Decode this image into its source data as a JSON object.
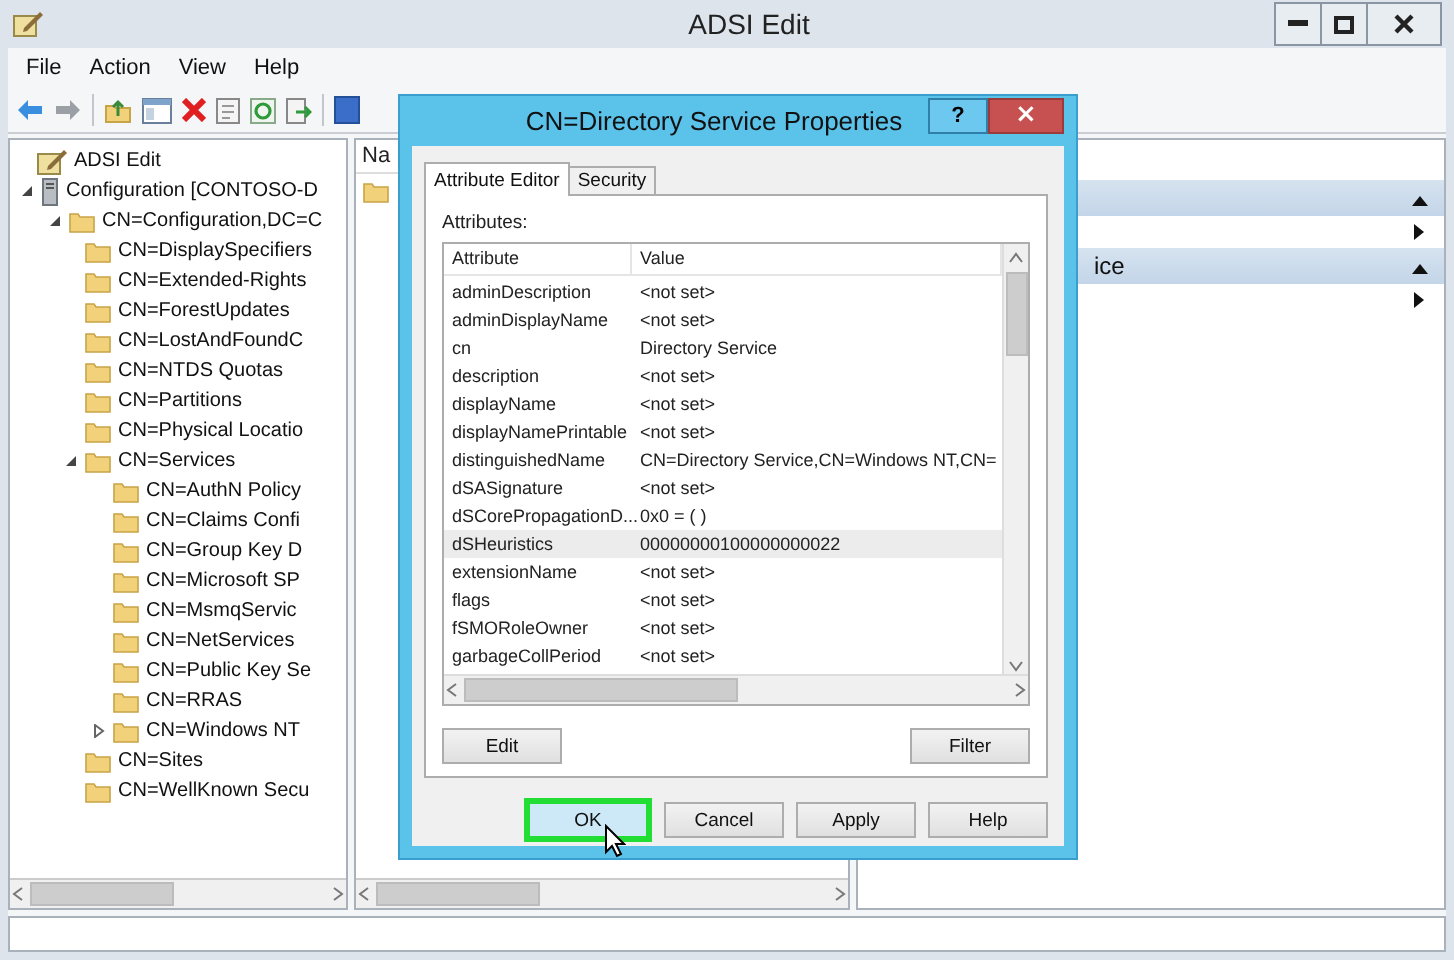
{
  "window": {
    "title": "ADSI Edit"
  },
  "menu": [
    "File",
    "Action",
    "View",
    "Help"
  ],
  "tree": [
    {
      "label": "ADSI Edit",
      "kind": "app",
      "children": [
        {
          "label": "Configuration [CONTOSO-D",
          "kind": "server",
          "expanded": true,
          "children": [
            {
              "label": "CN=Configuration,DC=C",
              "kind": "folder",
              "expanded": true,
              "children": [
                {
                  "label": "CN=DisplaySpecifiers",
                  "kind": "folder"
                },
                {
                  "label": "CN=Extended-Rights",
                  "kind": "folder"
                },
                {
                  "label": "CN=ForestUpdates",
                  "kind": "folder"
                },
                {
                  "label": "CN=LostAndFoundC",
                  "kind": "folder"
                },
                {
                  "label": "CN=NTDS Quotas",
                  "kind": "folder"
                },
                {
                  "label": "CN=Partitions",
                  "kind": "folder"
                },
                {
                  "label": "CN=Physical Locatio",
                  "kind": "folder"
                },
                {
                  "label": "CN=Services",
                  "kind": "folder",
                  "expanded": true,
                  "children": [
                    {
                      "label": "CN=AuthN Policy",
                      "kind": "folder"
                    },
                    {
                      "label": "CN=Claims Confi",
                      "kind": "folder"
                    },
                    {
                      "label": "CN=Group Key D",
                      "kind": "folder"
                    },
                    {
                      "label": "CN=Microsoft SP",
                      "kind": "folder"
                    },
                    {
                      "label": "CN=MsmqServic",
                      "kind": "folder"
                    },
                    {
                      "label": "CN=NetServices",
                      "kind": "folder"
                    },
                    {
                      "label": "CN=Public Key Se",
                      "kind": "folder"
                    },
                    {
                      "label": "CN=RRAS",
                      "kind": "folder"
                    },
                    {
                      "label": "CN=Windows NT",
                      "kind": "folder",
                      "expanded": false
                    }
                  ]
                },
                {
                  "label": "CN=Sites",
                  "kind": "folder"
                },
                {
                  "label": "CN=WellKnown Secu",
                  "kind": "folder"
                }
              ]
            }
          ]
        }
      ]
    }
  ],
  "middle_pane": {
    "column_1": "Na"
  },
  "actions": [
    {
      "expanded": true
    },
    {
      "title": "ice",
      "expanded": true
    }
  ],
  "dialog": {
    "title": "CN=Directory Service Properties",
    "help": "?",
    "close": "×",
    "tabs": [
      {
        "label": "Attribute Editor",
        "selected": true
      },
      {
        "label": "Security",
        "selected": false
      }
    ],
    "attributes_label": "Attributes:",
    "columns": [
      "Attribute",
      "Value"
    ],
    "rows": [
      {
        "attribute": "adminDescription",
        "value": "<not set>",
        "selected": false
      },
      {
        "attribute": "adminDisplayName",
        "value": "<not set>",
        "selected": false
      },
      {
        "attribute": "cn",
        "value": "Directory Service",
        "selected": false
      },
      {
        "attribute": "description",
        "value": "<not set>",
        "selected": false
      },
      {
        "attribute": "displayName",
        "value": "<not set>",
        "selected": false
      },
      {
        "attribute": "displayNamePrintable",
        "value": "<not set>",
        "selected": false
      },
      {
        "attribute": "distinguishedName",
        "value": "CN=Directory Service,CN=Windows NT,CN=",
        "selected": false
      },
      {
        "attribute": "dSASignature",
        "value": "<not set>",
        "selected": false
      },
      {
        "attribute": "dSCorePropagationD...",
        "value": "0x0 = ( )",
        "selected": false
      },
      {
        "attribute": "dSHeuristics",
        "value": "00000000100000000022",
        "selected": true
      },
      {
        "attribute": "extensionName",
        "value": "<not set>",
        "selected": false
      },
      {
        "attribute": "flags",
        "value": "<not set>",
        "selected": false
      },
      {
        "attribute": "fSMORoleOwner",
        "value": "<not set>",
        "selected": false
      },
      {
        "attribute": "garbageCollPeriod",
        "value": "<not set>",
        "selected": false
      }
    ],
    "edit_button": "Edit",
    "filter_button": "Filter",
    "footer_buttons": [
      {
        "label": "OK",
        "highlighted": true
      },
      {
        "label": "Cancel",
        "highlighted": false
      },
      {
        "label": "Apply",
        "highlighted": false
      },
      {
        "label": "Help",
        "highlighted": false
      }
    ]
  }
}
